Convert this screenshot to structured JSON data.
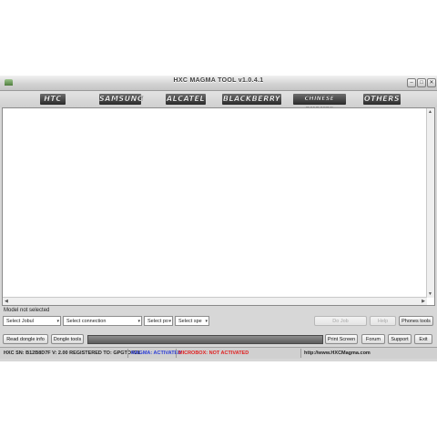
{
  "window": {
    "title": "HXC MAGMA TOOL v1.0.4.1",
    "minimize_glyph": "–",
    "maximize_glyph": "□",
    "close_glyph": "✕"
  },
  "brands": [
    "HTC",
    "SAMSUNG",
    "ALCATEL",
    "BLACKBERRY",
    "CHINESE PHONES",
    "OTHERS"
  ],
  "status": {
    "model": "Model not selected"
  },
  "selectors": {
    "job": "Select Jobul",
    "connection": "Select connection",
    "port": "Select po",
    "speed": "Select spe"
  },
  "buttons": {
    "do_job": "Do Job",
    "help": "Help",
    "phones_tools": "Phones tools",
    "read_dongle": "Read dongle info",
    "dongle_tools": "Dongle tools",
    "print_screen": "Print Screen",
    "forum": "Forum",
    "support": "Support",
    "exit": "Exit"
  },
  "statusbar": {
    "serial": "HXC SN: B12B8D7F V: 2.00 REGISTERED TO: GPGTOP21",
    "magma": "MAGMA: ACTIVATED",
    "microbox": "MICROBOX: NOT ACTIVATED",
    "url": "http://www.HXCMagma.com"
  },
  "colors": {
    "magma_status": "#2a3bd6",
    "microbox_status": "#e02020"
  },
  "icons": {
    "dropdown": "▾",
    "scroll_up": "▲",
    "scroll_down": "▼",
    "scroll_left": "◀",
    "scroll_right": "▶"
  }
}
